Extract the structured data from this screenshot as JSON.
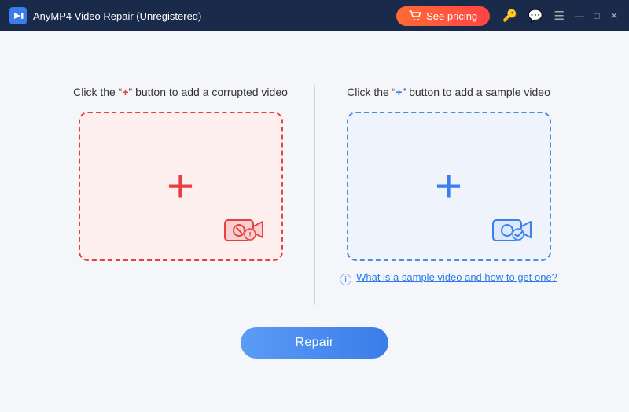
{
  "titleBar": {
    "appName": "AnyMP4 Video Repair (Unregistered)",
    "pricingLabel": "See pricing",
    "logoAlt": "AnyMP4 logo"
  },
  "leftPanel": {
    "label1": "Click the \"",
    "plus": "+",
    "label2": "\" button to add a corrupted video"
  },
  "rightPanel": {
    "label1": "Click the \"",
    "plus": "+",
    "label2": "\" button to add a sample video",
    "helpLinkText": "What is a sample video and how to get one?"
  },
  "repairButton": {
    "label": "Repair"
  }
}
